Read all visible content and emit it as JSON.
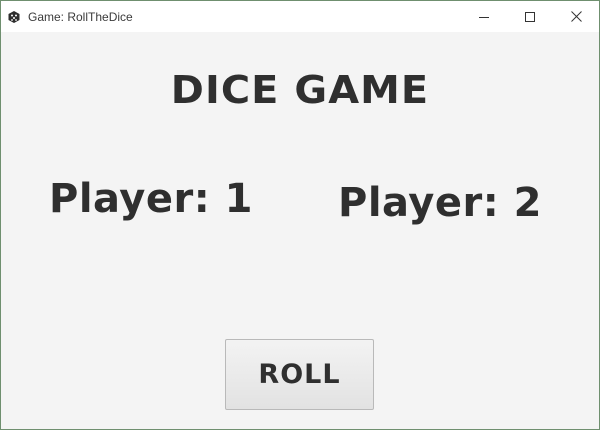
{
  "window": {
    "title": "Game: RollTheDice",
    "icon": "dice-icon",
    "controls": [
      "minimize-icon",
      "maximize-icon",
      "close-icon"
    ]
  },
  "main": {
    "heading": "DICE GAME",
    "players": [
      {
        "label": "Player: 1"
      },
      {
        "label": "Player: 2"
      }
    ],
    "roll_button_label": "ROLL"
  }
}
